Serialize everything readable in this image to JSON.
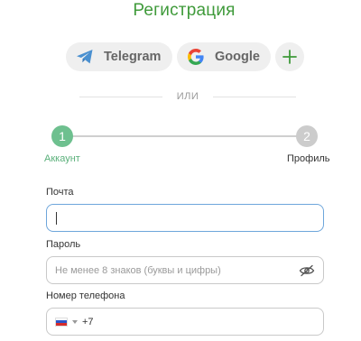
{
  "title": "Регистрация",
  "social": {
    "telegram_label": "Telegram",
    "google_label": "Google",
    "more_icon": "plus-icon"
  },
  "divider_text": "ИЛИ",
  "steps": [
    {
      "number": "1",
      "label": "Аккаунт",
      "state": "active"
    },
    {
      "number": "2",
      "label": "Профиль",
      "state": "inactive"
    }
  ],
  "fields": {
    "email": {
      "label": "Почта",
      "value": ""
    },
    "password": {
      "label": "Пароль",
      "placeholder": "Не менее 8 знаков (буквы и цифры)"
    },
    "phone": {
      "label": "Номер телефона",
      "country": "RU",
      "code": "+7"
    }
  },
  "colors": {
    "title": "#3f9a3a",
    "step_active": "#6ec08f",
    "step_inactive": "#cccccc",
    "focus_border": "#6ea6db"
  }
}
